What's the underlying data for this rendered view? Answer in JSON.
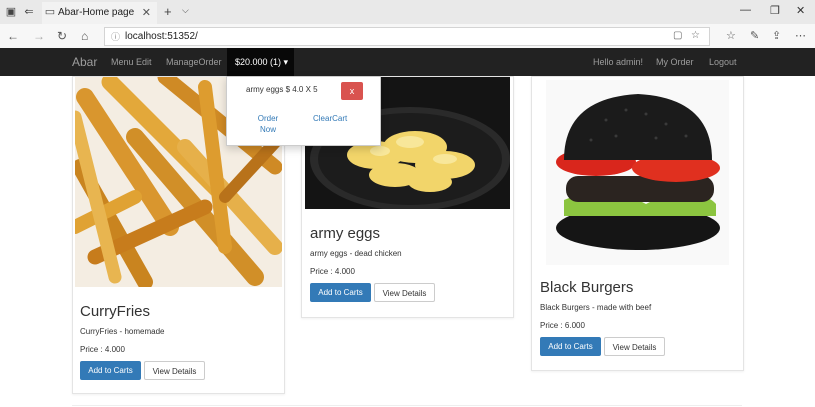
{
  "browser": {
    "tab_title": "Abar-Home page",
    "tab_close": "✕",
    "new_tab": "+",
    "tab_dropdown": "⌵",
    "url": "localhost:51352/",
    "minimize": "—",
    "restore": "❐",
    "close": "✕",
    "icons": [
      "tab-preview-icon",
      "tab-back-icon",
      "back-icon",
      "forward-icon",
      "refresh-icon",
      "home-icon",
      "info-icon",
      "reading-view-icon",
      "favorite-star-icon",
      "favorites-hub-icon",
      "web-note-icon",
      "share-icon",
      "more-icon"
    ]
  },
  "navbar": {
    "brand": "Abar",
    "menu_edit": "Menu Edit",
    "manage_order": "ManageOrder",
    "cart": "$20.000 (1) ▾",
    "hello": "Hello admin!",
    "my_order": "My Order",
    "logout": "Logout"
  },
  "cart_dropdown": {
    "item": "army eggs $ 4.0 X 5",
    "remove_label": "x",
    "order_now": "Order Now",
    "clear_cart": "ClearCart"
  },
  "products": [
    {
      "name": "CurryFries",
      "description": "CurryFries - homemade",
      "price": "Price : 4.000",
      "add_label": "Add to Carts",
      "details_label": "View Details"
    },
    {
      "name": "army eggs",
      "description": "army eggs - dead chicken",
      "price": "Price : 4.000",
      "add_label": "Add to Carts",
      "details_label": "View Details"
    },
    {
      "name": "Black Burgers",
      "description": "Black Burgers - made with beef",
      "price": "Price : 6.000",
      "add_label": "Add to Carts",
      "details_label": "View Details"
    }
  ],
  "colors": {
    "navbar_bg": "#222222",
    "primary": "#337ab7",
    "danger": "#d9534f",
    "link": "#337ab7"
  }
}
